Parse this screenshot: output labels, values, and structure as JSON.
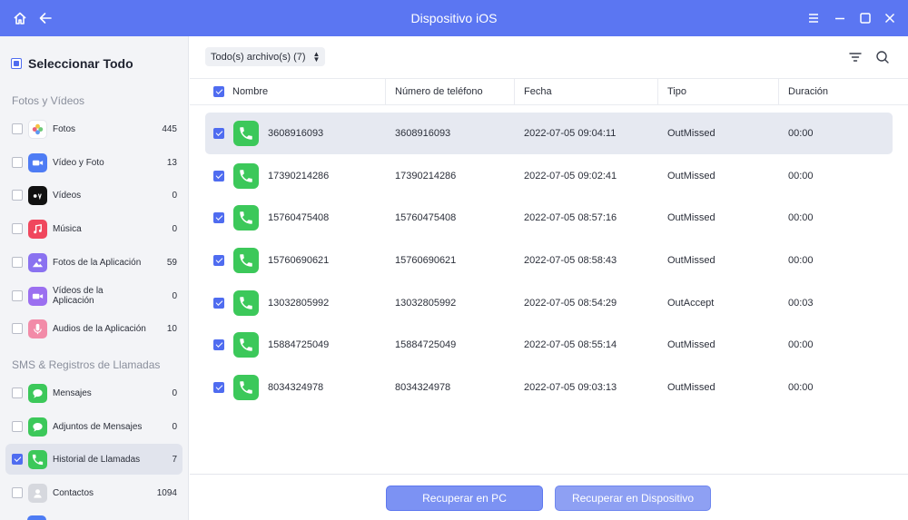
{
  "window": {
    "title": "Dispositivo iOS"
  },
  "colors": {
    "accent": "#5b76f2",
    "phone_green": "#3cc85a"
  },
  "sidebar": {
    "select_all_label": "Seleccionar Todo",
    "sections": [
      {
        "title": "Fotos y Vídeos",
        "items": [
          {
            "label": "Fotos",
            "count": "445",
            "icon": "photos-icon",
            "checked": false
          },
          {
            "label": "Vídeo y Foto",
            "count": "13",
            "icon": "video-camera-icon",
            "checked": false
          },
          {
            "label": "Vídeos",
            "count": "0",
            "icon": "apple-tv-icon",
            "checked": false
          },
          {
            "label": "Música",
            "count": "0",
            "icon": "music-note-icon",
            "checked": false
          },
          {
            "label": "Fotos de la Aplicación",
            "count": "59",
            "icon": "app-photos-icon",
            "checked": false
          },
          {
            "label": "Vídeos de la Aplicación",
            "count": "0",
            "icon": "app-videos-icon",
            "checked": false
          },
          {
            "label": "Audios de la Aplicación",
            "count": "10",
            "icon": "microphone-icon",
            "checked": false
          }
        ]
      },
      {
        "title": "SMS & Registros de Llamadas",
        "items": [
          {
            "label": "Mensajes",
            "count": "0",
            "icon": "messages-icon",
            "checked": false
          },
          {
            "label": "Adjuntos de Mensajes",
            "count": "0",
            "icon": "message-attachments-icon",
            "checked": false
          },
          {
            "label": "Historial de Llamadas",
            "count": "7",
            "icon": "phone-icon",
            "checked": true
          },
          {
            "label": "Contactos",
            "count": "1094",
            "icon": "contacts-icon",
            "checked": false
          }
        ]
      }
    ]
  },
  "toolbar": {
    "filter_label": "Todo(s) archivo(s) (7)",
    "filter_icon": "filter-icon",
    "search_icon": "search-icon"
  },
  "table": {
    "columns": [
      "Nombre",
      "Número de teléfono",
      "Fecha",
      "Tipo",
      "Duración"
    ],
    "rows": [
      {
        "name": "3608916093",
        "phone": "3608916093",
        "date": "2022-07-05 09:04:11",
        "type": "OutMissed",
        "duration": "00:00"
      },
      {
        "name": "17390214286",
        "phone": "17390214286",
        "date": "2022-07-05 09:02:41",
        "type": "OutMissed",
        "duration": "00:00"
      },
      {
        "name": "15760475408",
        "phone": "15760475408",
        "date": "2022-07-05 08:57:16",
        "type": "OutMissed",
        "duration": "00:00"
      },
      {
        "name": "15760690621",
        "phone": "15760690621",
        "date": "2022-07-05 08:58:43",
        "type": "OutMissed",
        "duration": "00:00"
      },
      {
        "name": "13032805992",
        "phone": "13032805992",
        "date": "2022-07-05 08:54:29",
        "type": "OutAccept",
        "duration": "00:03"
      },
      {
        "name": "15884725049",
        "phone": "15884725049",
        "date": "2022-07-05 08:55:14",
        "type": "OutMissed",
        "duration": "00:00"
      },
      {
        "name": "8034324978",
        "phone": "8034324978",
        "date": "2022-07-05 09:03:13",
        "type": "OutMissed",
        "duration": "00:00"
      }
    ]
  },
  "footer": {
    "recover_pc_label": "Recuperar en PC",
    "recover_device_label": "Recuperar en Dispositivo"
  }
}
